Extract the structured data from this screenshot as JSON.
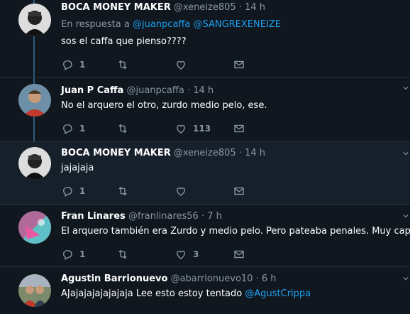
{
  "tweets": [
    {
      "name": "BOCA MONEY MAKER",
      "handle": "@xeneize805",
      "time": "14 h",
      "reply_prefix": "En respuesta a",
      "reply_mentions": "@juanpcaffa @SANGREXENEIZE",
      "text": "sos el caffa que pienso????",
      "replies": "1",
      "likes": ""
    },
    {
      "name": "Juan P Caffa",
      "handle": "@juanpcaffa",
      "time": "14 h",
      "text": "No el arquero el otro, zurdo medio pelo, ese.",
      "replies": "1",
      "likes": "113"
    },
    {
      "name": "BOCA MONEY MAKER",
      "handle": "@xeneize805",
      "time": "14 h",
      "text": "jajajaja",
      "replies": "1",
      "likes": ""
    },
    {
      "name": "Fran Linares",
      "handle": "@franlinares56",
      "time": "7 h",
      "text": "El arquero también era Zurdo y medio pelo. Pero pateaba penales. Muy capo",
      "replies": "1",
      "likes": "3"
    },
    {
      "name": "Agustin Barrionuevo",
      "handle": "@abarrionuevo10",
      "time": "6 h",
      "text": "AJajajajajajajaja Lee esto estoy tentado",
      "text_mention": "@AgustCrippa",
      "replies": "",
      "likes": ""
    }
  ],
  "separator": "·",
  "icons": [
    "reply-icon",
    "retweet-icon",
    "like-icon",
    "message-icon",
    "chevron-down-icon"
  ],
  "colors": {
    "background": "#10171e",
    "link": "#1da1f2",
    "muted": "#8899a6",
    "thread_line": "#2f5a7c"
  }
}
